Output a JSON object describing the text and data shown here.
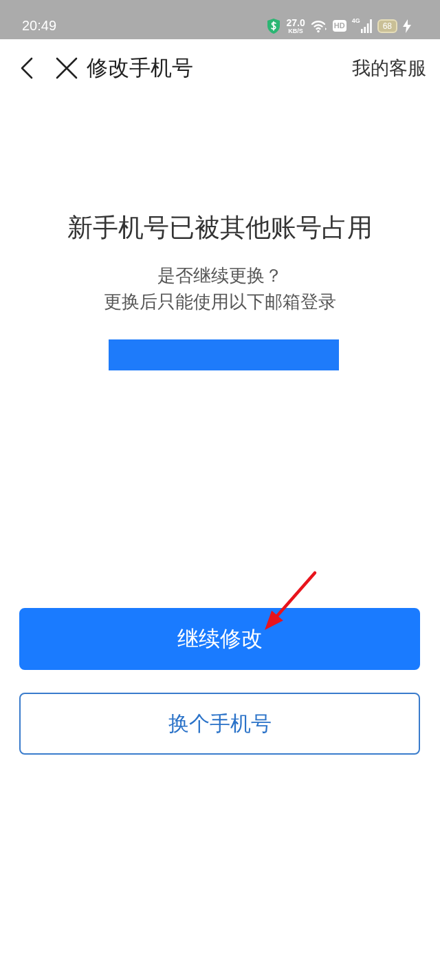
{
  "status_bar": {
    "time": "20:49",
    "net_speed": "27.0",
    "net_speed_unit": "KB/S",
    "hd_badge": "HD",
    "network": "4G",
    "battery": "68",
    "charging": true
  },
  "nav_bar": {
    "title": "修改手机号",
    "right_link": "我的客服"
  },
  "notice": {
    "title": "新手机号已被其他账号占用",
    "lines": [
      "是否继续更换？",
      "更换后只能使用以下邮箱登录"
    ]
  },
  "buttons": [
    {
      "label": "继续修改",
      "kind": "primary"
    },
    {
      "label": "换个手机号",
      "kind": "outline"
    }
  ]
}
